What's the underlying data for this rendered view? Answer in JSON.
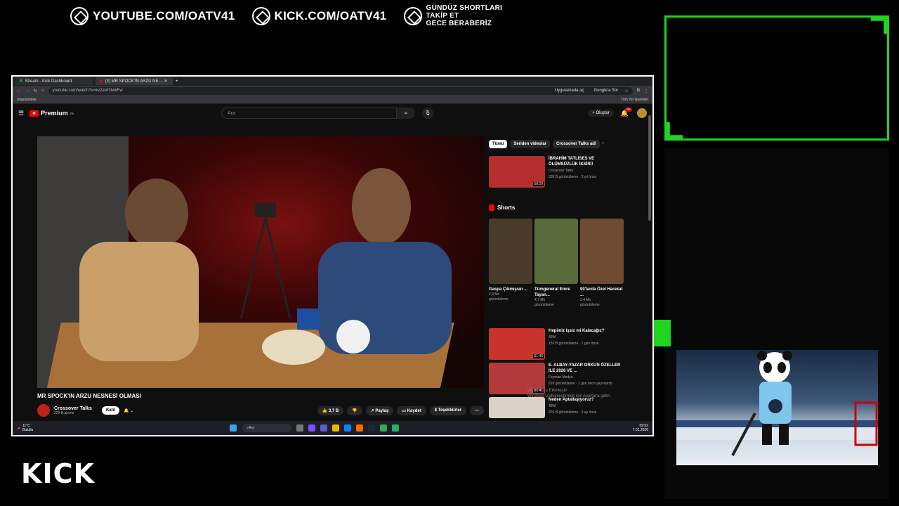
{
  "overlay": {
    "youtube": "YOUTUBE.COM/OATV41",
    "kick": "KICK.COM/OATV41",
    "shorts_line1": "GÜNDÜZ SHORTLARI",
    "shorts_line2": "TAKİP ET",
    "shorts_line3": "GECE BERABERİZ",
    "kick_logo": "KICK"
  },
  "browser": {
    "tabs": [
      {
        "label": "Stream - Kick Dashboard"
      },
      {
        "label": "(3) MR SPOCK'IN ARZU NE..."
      }
    ],
    "url": "youtube.com/watch?v=kv2aVIOwkFw",
    "open_in_app": "Uygulamada aç",
    "google_label": "Google'a Sor",
    "bookmarks_apps": "Uygulamalar",
    "bookmarks_all": "Tüm Yer İşaretleri"
  },
  "youtube": {
    "brand": "Premium",
    "brand_suffix": "TR",
    "search_placeholder": "Ara",
    "create": "Oluştur",
    "notif_count": "9+",
    "video_title": "MR SPOCK'IN ARZU NESNESİ OLMASI",
    "channel_name": "Crossover Talks",
    "channel_subs": "229 B abone",
    "join": "Katıl",
    "likes": "3,7 B",
    "share": "Paylaş",
    "save": "Kaydet",
    "thanks": "Teşekkürler",
    "chips": [
      "Tümü",
      "Seriden videolar",
      "Crossover Talks adl"
    ],
    "rec_top": {
      "title": "İBRAHİM TATLISES VE ÖLÜMSÜZLÜK İKSİRİ!",
      "channel": "Crossover Talks",
      "meta": "239 B görüntüleme · 3 yıl önce",
      "duration": "50:20"
    },
    "shorts_label": "Shorts",
    "shorts": [
      {
        "title": "Gaspa Çıkmışsın ...",
        "meta1": "2,4 Mn",
        "meta2": "görüntüleme"
      },
      {
        "title": "Tümgeneral Emre Tayan...",
        "meta1": "4,7 Mn",
        "meta2": "görüntüleme"
      },
      {
        "title": "90'larda Özel Harekat ...",
        "meta1": "2,4 Mn",
        "meta2": "görüntüleme"
      }
    ],
    "recs": [
      {
        "title": "Hepimiz işsiz mi Kalacağız?",
        "channel": "49W",
        "meta": "153 B görüntüleme · 7 gün önce",
        "duration": "51:46"
      },
      {
        "title": "E. ALBAY-YAZAR ORKUN ÖZELLER İLE 2026 VE ...",
        "channel": "Feyman Medya",
        "meta": "626 görüntüleme · 1 gün önce yayınlandı",
        "duration": "53:41"
      },
      {
        "title": "Neden Aptallaşıyoruz?",
        "channel": "49W",
        "meta": "201 B görüntüleme · 3 ay önce",
        "duration": ""
      }
    ],
    "windows_watermark_1": "Windows'u Etkinleştir",
    "windows_watermark_2": "Windows'u etkinleştirmek için Ayarlar'a gidin."
  },
  "taskbar": {
    "weather_temp": "11°C",
    "weather_desc": "Bulutlu",
    "search": "Ara",
    "time": "09:52",
    "date": "7.01.2026"
  },
  "colors": {
    "overlay_green": "#1fd51f",
    "youtube_red": "#ff0000"
  }
}
